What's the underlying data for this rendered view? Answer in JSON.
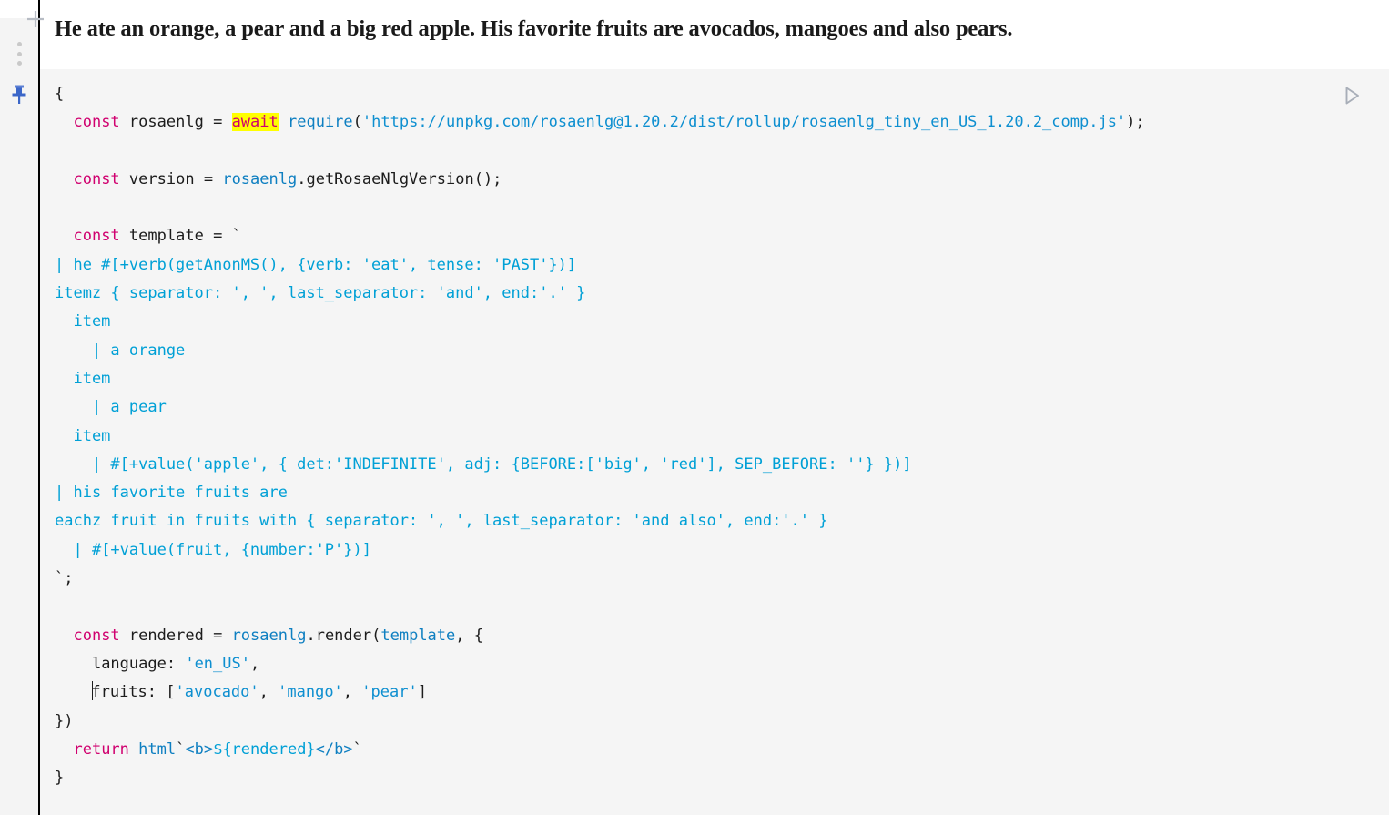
{
  "gutter": {
    "add_icon": "plus-icon",
    "menu_icon": "kebab-menu-icon",
    "pin_icon": "pin-icon"
  },
  "output": {
    "text": "He ate an orange, a pear and a big red apple. His favorite fruits are avocados, mangoes and also pears."
  },
  "editor": {
    "run_icon": "play-icon",
    "language": "javascript",
    "highlighted_token": "await",
    "colors": {
      "keyword": "#d0006f",
      "string": "#0e8fd0",
      "template": "#00a0d6",
      "function": "#0e7fc1",
      "highlight_bg": "#ffff00",
      "editor_bg": "#f5f5f5",
      "gutter_bg": "#f4f4f4",
      "output_bg": "#ffffff"
    },
    "code_lines": [
      "{",
      "  const rosaenlg = await require('https://unpkg.com/rosaenlg@1.20.2/dist/rollup/rosaenlg_tiny_en_US_1.20.2_comp.js');",
      "",
      "  const version = rosaenlg.getRosaeNlgVersion();",
      "",
      "  const template = `",
      "| he #[+verb(getAnonMS(), {verb: 'eat', tense: 'PAST'})]",
      "itemz { separator: ', ', last_separator: 'and', end:'.' }",
      "  item",
      "    | a orange",
      "  item",
      "    | a pear",
      "  item",
      "    | #[+value('apple', { det:'INDEFINITE', adj: {BEFORE:['big', 'red'], SEP_BEFORE: ''} })]",
      "| his favorite fruits are",
      "eachz fruit in fruits with { separator: ', ', last_separator: 'and also', end:'.' }",
      "  | #[+value(fruit, {number:'P'})]",
      "`;",
      "",
      "  const rendered = rosaenlg.render(template, {",
      "    language: 'en_US',",
      "    fruits: ['avocado', 'mango', 'pear']",
      "})",
      "  return html`<b>${rendered}</b>`",
      "}"
    ],
    "tokens": {
      "const": "const",
      "await": "await",
      "return": "return",
      "rosaenlg_var": "rosaenlg",
      "version_var": "version",
      "template_var": "template",
      "rendered_var": "rendered",
      "require": "require",
      "url": "https://unpkg.com/rosaenlg@1.20.2/dist/rollup/rosaenlg_tiny_en_US_1.20.2_comp.js",
      "get_version_call": "rosaenlg.getRosaeNlgVersion();",
      "render_call": "rosaenlg.render(template, {",
      "language_key": "language:",
      "language_value": "'en_US'",
      "fruits_key": "fruits:",
      "fruits_value": "['avocado', 'mango', 'pear']",
      "html_tag": "html",
      "return_expr": "<b>${rendered}</b>"
    }
  }
}
